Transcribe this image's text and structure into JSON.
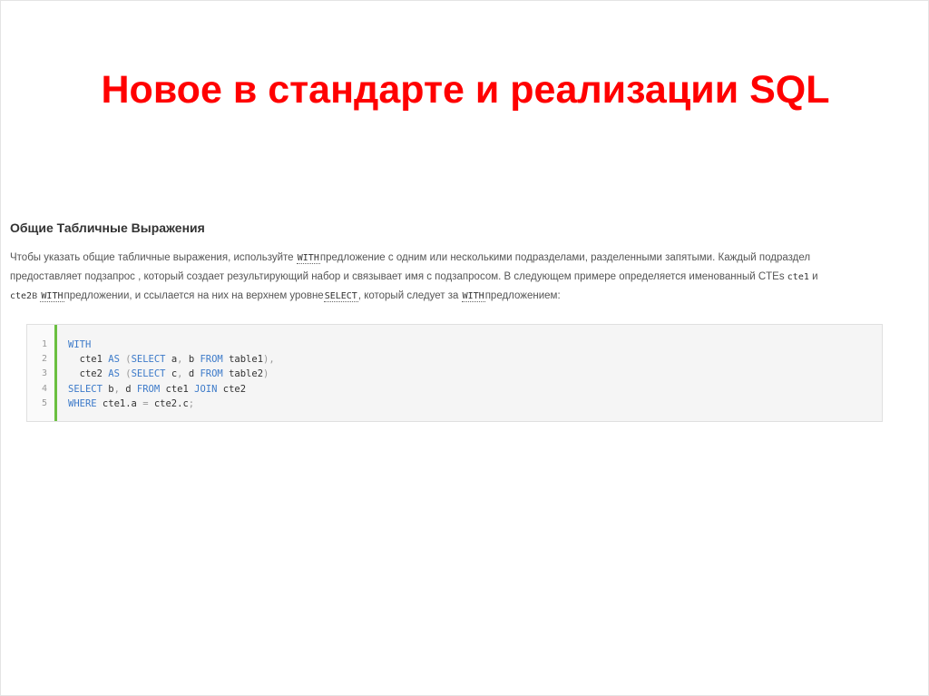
{
  "slide": {
    "title": "Новое в стандарте и реализации SQL"
  },
  "article": {
    "heading": "Общие Табличные Выражения",
    "paragraph": {
      "p1": "Чтобы указать общие табличные выражения, используйте ",
      "with1": "WITH",
      "p2": "предложение с одним или несколькими подразделами, разделенными запятыми. Каждый подраздел предоставляет подзапрос , который создает результирующий набор и связывает имя с подзапросом. В следующем примере определяется именованный CTEs ",
      "cte1": "cte1",
      "p3": " и ",
      "cte2": "cte2",
      "p4": "в ",
      "with2": "WITH",
      "p5": "предложении, и ссылается на них на верхнем уровне",
      "select": "SELECT",
      "p6": ", который следует за ",
      "with3": "WITH",
      "p7": "предложением:"
    }
  },
  "code": {
    "line_numbers": [
      "1",
      "2",
      "3",
      "4",
      "5"
    ],
    "accent_color": "#6abf40",
    "keyword_color": "#3c7ac9",
    "lines": {
      "l1": {
        "kw1": "WITH"
      },
      "l2": {
        "indent": "  ",
        "t1": "cte1 ",
        "kw1": "AS",
        "t2": " (",
        "kw2": "SELECT",
        "t3": " a",
        "t4": ",",
        "t5": " b ",
        "kw3": "FROM",
        "t6": " table1",
        "t7": "),"
      },
      "l3": {
        "indent": "  ",
        "t1": "cte2 ",
        "kw1": "AS",
        "t2": " (",
        "kw2": "SELECT",
        "t3": " c",
        "t4": ",",
        "t5": " d ",
        "kw3": "FROM",
        "t6": " table2",
        "t7": ")"
      },
      "l4": {
        "kw1": "SELECT",
        "t1": " b",
        "t2": ",",
        "t3": " d ",
        "kw2": "FROM",
        "t4": " cte1 ",
        "kw3": "JOIN",
        "t5": " cte2"
      },
      "l5": {
        "kw1": "WHERE",
        "t1": " cte1.a ",
        "t2": "=",
        "t3": " cte2.c",
        "t4": ";"
      }
    }
  }
}
